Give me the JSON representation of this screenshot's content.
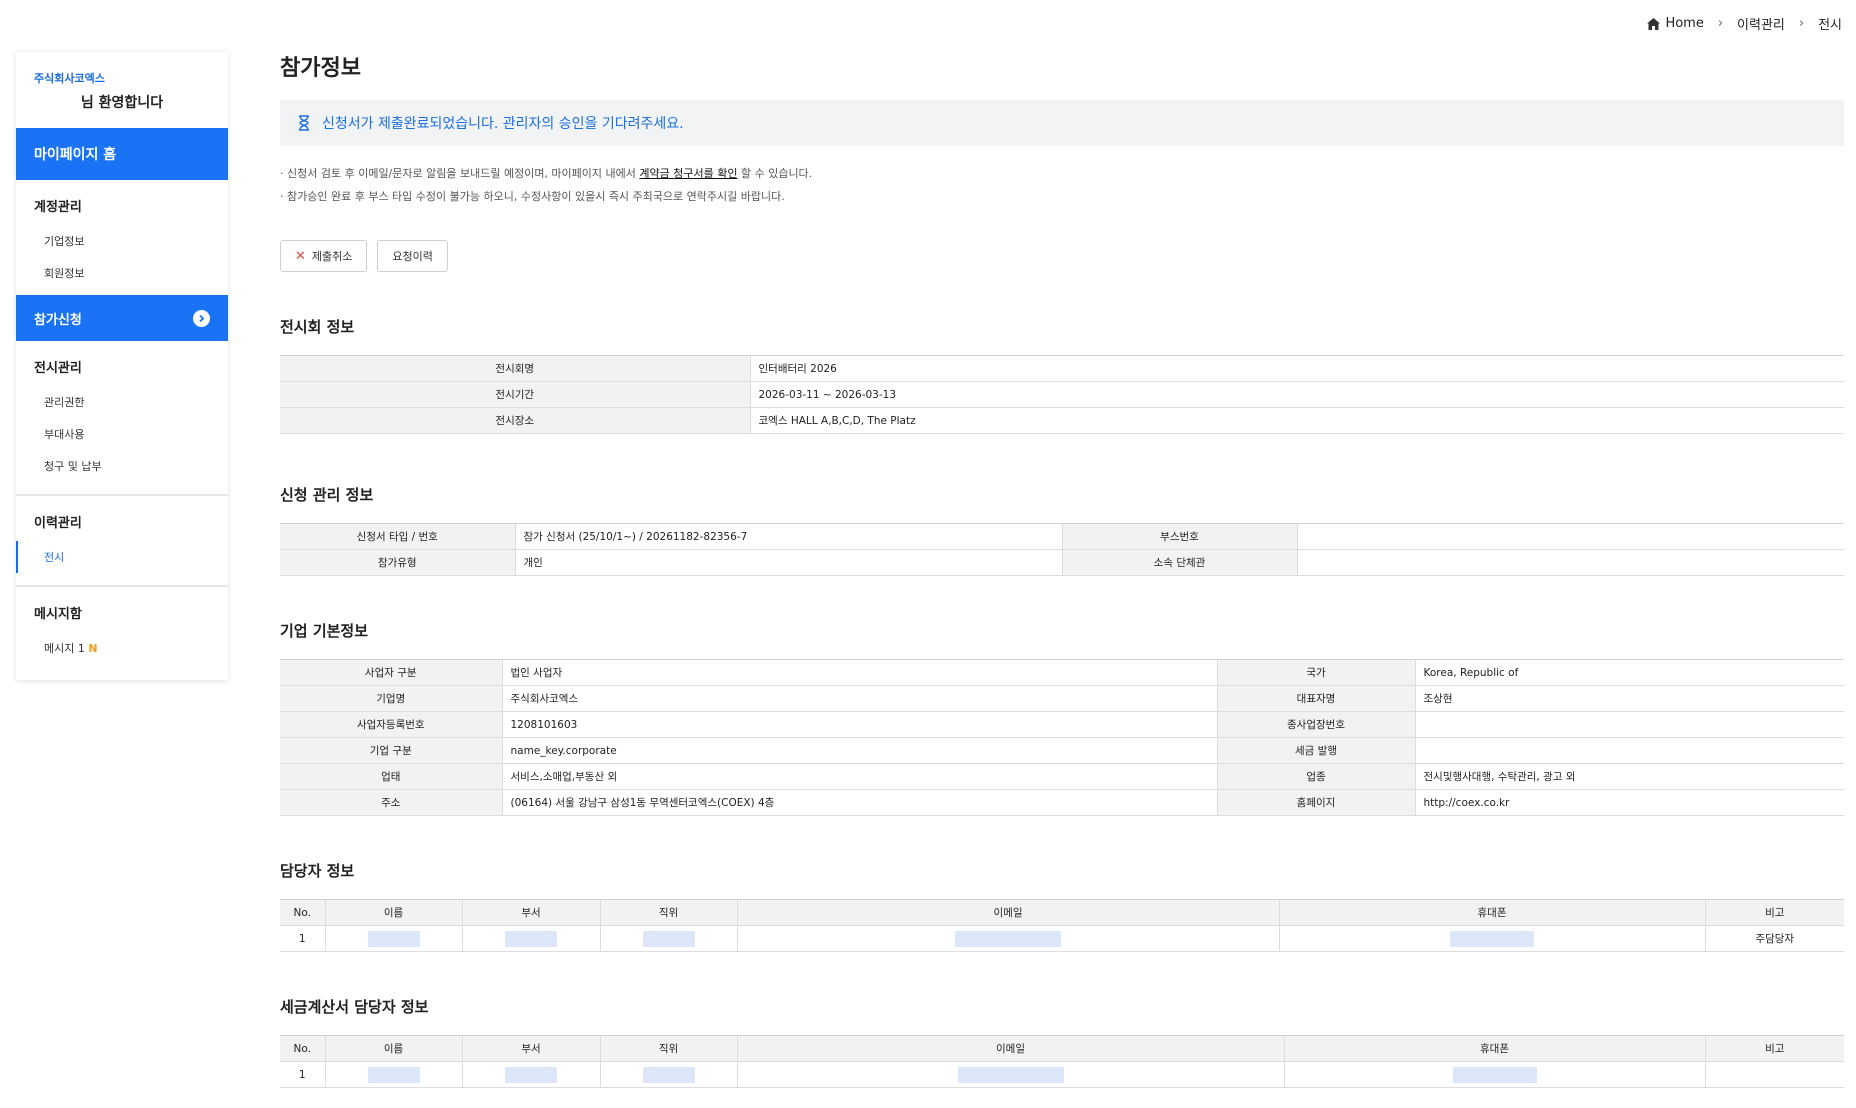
{
  "breadcrumb": {
    "home": "Home",
    "level1": "이력관리",
    "level2": "전시"
  },
  "sidebar": {
    "company": "주식회사코엑스",
    "greeting": "님 환영합니다",
    "mypage_home": "마이페이지 홈",
    "account": {
      "title": "계정관리",
      "items": [
        "기업정보",
        "회원정보"
      ]
    },
    "apply": "참가신청",
    "exhibit": {
      "title": "전시관리",
      "items": [
        "관리권한",
        "부대사용",
        "청구 및 납부"
      ]
    },
    "history": {
      "title": "이력관리",
      "items": [
        "전시"
      ]
    },
    "message": {
      "title": "메시지함",
      "item": "메시지 1",
      "badge": "N"
    }
  },
  "page": {
    "title": "참가정보",
    "notice": "신청서가 제출완료되었습니다. 관리자의 승인을 기다려주세요.",
    "info1_before": "· 신청서 검토 후 이메일/문자로 알림을 보내드릴 예정이며, 마이페이지 내에서 ",
    "info1_link": "계약금 청구서를 확인",
    "info1_after": " 할 수 있습니다.",
    "info2": "· 참가승인 완료 후 부스 타입 수정이 불가능 하오니, 수정사항이 있을시 즉시 주최국으로 연락주시길 바랍니다.",
    "cancel_button": "제출취소",
    "history_button": "요청이력"
  },
  "exhibition": {
    "title": "전시회 정보",
    "rows": [
      {
        "label": "전시회명",
        "value": "인터배터리 2026"
      },
      {
        "label": "전시기간",
        "value": "2026-03-11 ~ 2026-03-13"
      },
      {
        "label": "전시장소",
        "value": "코엑스 HALL A,B,C,D, The Platz"
      }
    ]
  },
  "application": {
    "title": "신청 관리 정보",
    "rows": [
      {
        "label1": "신청서 타입 / 번호",
        "value1": "참가 신청서 (25/10/1~) / 20261182-82356-7",
        "label2": "부스번호",
        "value2": ""
      },
      {
        "label1": "참가유형",
        "value1": "개인",
        "label2": "소속 단체관",
        "value2": ""
      }
    ]
  },
  "company": {
    "title": "기업 기본정보",
    "rows": [
      {
        "label1": "사업자 구분",
        "value1": "법인 사업자",
        "label2": "국가",
        "value2": "Korea, Republic of"
      },
      {
        "label1": "기업명",
        "value1": "주식회사코엑스",
        "label2": "대표자명",
        "value2": "조상현"
      },
      {
        "label1": "사업자등록번호",
        "value1": "1208101603",
        "label2": "종사업장번호",
        "value2": ""
      },
      {
        "label1": "기업 구분",
        "value1": "name_key.corporate",
        "label2": "세금 발행",
        "value2": ""
      },
      {
        "label1": "업태",
        "value1": "서비스,소매업,부동산 외",
        "label2": "업종",
        "value2": "전시및행사대행, 수탁관리, 광고 외"
      },
      {
        "label1": "주소",
        "value1": "(06164) 서울 강남구 삼성1동 무역센터코엑스(COEX) 4층",
        "label2": "홈페이지",
        "value2": "http://coex.co.kr"
      }
    ]
  },
  "manager": {
    "title": "담당자 정보",
    "headers": [
      "No.",
      "이름",
      "부서",
      "직위",
      "이메일",
      "휴대폰",
      "비고"
    ],
    "row": {
      "no": "1",
      "note": "주담당자"
    }
  },
  "tax_manager": {
    "title": "세금계산서 담당자 정보",
    "headers": [
      "No.",
      "이름",
      "부서",
      "직위",
      "이메일",
      "휴대폰",
      "비고"
    ],
    "row": {
      "no": "1",
      "note": ""
    }
  },
  "colors": {
    "accent": "#1a73f5",
    "badge": "#f39c12",
    "cancel": "#e74c3c"
  }
}
